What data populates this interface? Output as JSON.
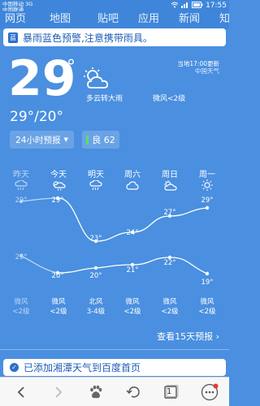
{
  "status_bar": {
    "carrier1": "中国移动 3G",
    "carrier2": "中国联通",
    "time": "17:55"
  },
  "topnav": {
    "items": [
      "网页",
      "地图",
      "贴吧",
      "应用",
      "新闻",
      "知"
    ]
  },
  "alert": {
    "badge": "蓝",
    "text": "暴雨蓝色预警,注意携带雨具。"
  },
  "current": {
    "temp": "29",
    "deg": "°",
    "condition": "多云转大雨",
    "wind": "微风<2级",
    "update": "当地17:00更新",
    "source": "中国天气",
    "range": "29°/20°"
  },
  "controls": {
    "forecast_label": "24小时预报",
    "aq_label": "良 62"
  },
  "days": [
    {
      "name": "昨天",
      "icon": "rain-icon",
      "high": "29°",
      "low": "23°",
      "wind_dir": "微风",
      "wind_level": "<2级",
      "past": true
    },
    {
      "name": "今天",
      "icon": "sun-rain-icon",
      "high": "29°",
      "low": "20°",
      "wind_dir": "微风",
      "wind_level": "<2级",
      "past": false
    },
    {
      "name": "明天",
      "icon": "rain-icon",
      "high": "23°",
      "low": "20°",
      "wind_dir": "北风",
      "wind_level": "3-4级",
      "past": false
    },
    {
      "name": "周六",
      "icon": "cloud-icon",
      "high": "24°",
      "low": "21°",
      "wind_dir": "微风",
      "wind_level": "<2级",
      "past": false
    },
    {
      "name": "周日",
      "icon": "partly-cloudy-icon",
      "high": "27°",
      "low": "22°",
      "wind_dir": "微风",
      "wind_level": "<2级",
      "past": false
    },
    {
      "name": "周一",
      "icon": "sun-icon",
      "high": "29°",
      "low": "19°",
      "wind_dir": "微风",
      "wind_level": "<2级",
      "past": false
    }
  ],
  "more_link": "查看15天预报 ›",
  "added_text": "已添加湘潭天气到百度首页",
  "toolbar": {
    "tab_count": "1"
  }
}
